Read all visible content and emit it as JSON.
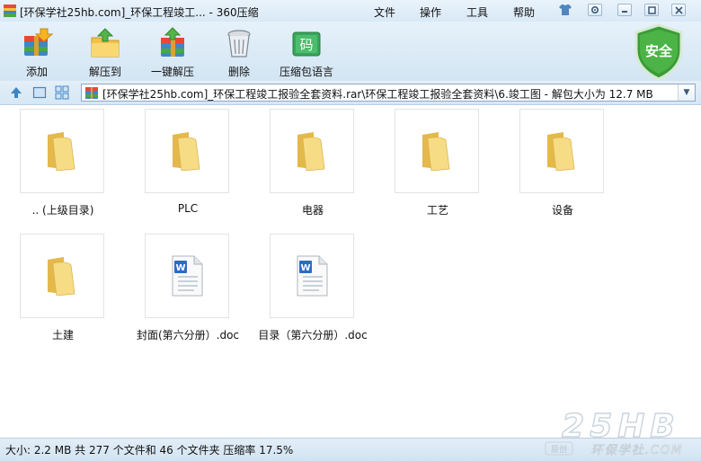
{
  "window": {
    "title": "[环保学社25hb.com]_环保工程竣工... - 360压缩",
    "menu": [
      "文件",
      "操作",
      "工具",
      "帮助"
    ]
  },
  "toolbar": {
    "add": "添加",
    "extract_to": "解压到",
    "one_click_extract": "一键解压",
    "delete": "删除",
    "lang": "压缩包语言",
    "lang_icon_char": "码",
    "security_badge": "安全"
  },
  "address": {
    "path": "[环保学社25hb.com]_环保工程竣工报验全套资料.rar\\环保工程竣工报验全套资料\\6.竣工图 - 解包大小为 12.7 MB"
  },
  "items": [
    {
      "name": ".. (上级目录)",
      "type": "folder"
    },
    {
      "name": "PLC",
      "type": "folder"
    },
    {
      "name": "电器",
      "type": "folder"
    },
    {
      "name": "工艺",
      "type": "folder"
    },
    {
      "name": "设备",
      "type": "folder"
    },
    {
      "name": "土建",
      "type": "folder"
    },
    {
      "name": "封面(第六分册）.doc",
      "type": "doc"
    },
    {
      "name": "目录（第六分册）.doc",
      "type": "doc"
    }
  ],
  "status": {
    "text": "大小: 2.2 MB 共 277 个文件和 46 个文件夹 压缩率 17.5%"
  },
  "watermark": {
    "big": "25HB",
    "small": "环保学社.COM",
    "badge": "原创"
  }
}
